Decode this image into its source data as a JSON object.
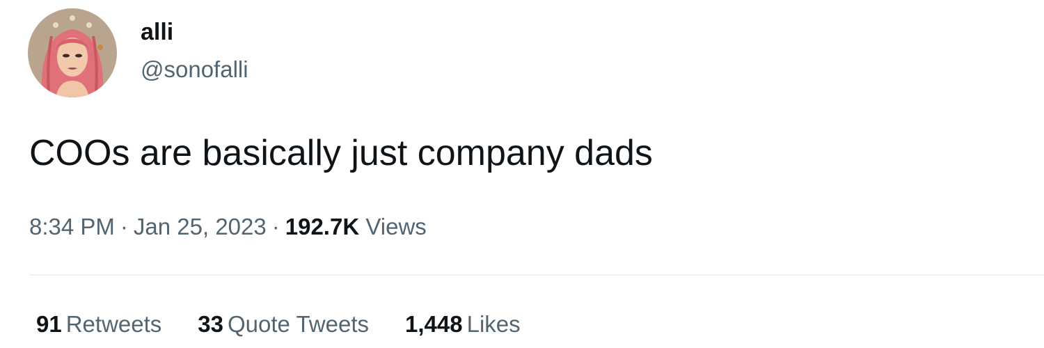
{
  "author": {
    "display_name": "alli",
    "handle": "@sonofalli",
    "avatar": "cartoon-woman-pink-hair-avatar"
  },
  "tweet": {
    "text": "COOs are basically just company dads",
    "time": "8:34 PM",
    "separator": "·",
    "date": "Jan 25, 2023",
    "views_count": "192.7K",
    "views_label": "Views"
  },
  "stats": [
    {
      "count": "91",
      "label": "Retweets"
    },
    {
      "count": "33",
      "label": "Quote Tweets"
    },
    {
      "count": "1,448",
      "label": "Likes"
    }
  ],
  "colors": {
    "primary_text": "#0f1419",
    "secondary_text": "#536471",
    "divider": "#eff3f4",
    "background": "#ffffff"
  }
}
